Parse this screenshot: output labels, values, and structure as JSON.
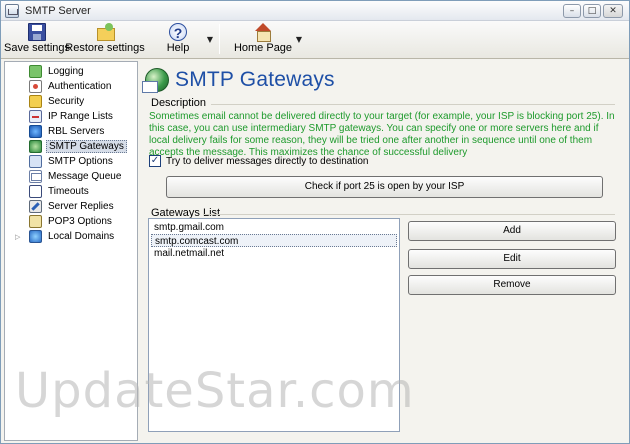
{
  "window": {
    "title": "SMTP Server"
  },
  "titlebar": {
    "minimize": "–",
    "maximize": "□",
    "close": "✕"
  },
  "toolbar": {
    "save_label": "Save settings",
    "restore_label": "Restore settings",
    "help_label": "Help",
    "help_glyph": "?",
    "home_label": "Home Page",
    "dropdown_glyph": "▼"
  },
  "sidebar": {
    "expand_glyph": "▷",
    "items": [
      {
        "label": "Logging",
        "icon": "logging-icon"
      },
      {
        "label": "Authentication",
        "icon": "authentication-icon"
      },
      {
        "label": "Security",
        "icon": "lock-icon"
      },
      {
        "label": "IP Range Lists",
        "icon": "ip-list-icon"
      },
      {
        "label": "RBL Servers",
        "icon": "globe-icon"
      },
      {
        "label": "SMTP Gateways",
        "icon": "gateway-icon",
        "selected": true
      },
      {
        "label": "SMTP Options",
        "icon": "options-icon"
      },
      {
        "label": "Message Queue",
        "icon": "queue-icon"
      },
      {
        "label": "Timeouts",
        "icon": "clock-icon"
      },
      {
        "label": "Server Replies",
        "icon": "reply-icon"
      },
      {
        "label": "POP3 Options",
        "icon": "pop3-icon"
      },
      {
        "label": "Local Domains",
        "icon": "domains-icon"
      }
    ]
  },
  "main": {
    "title": "SMTP Gateways",
    "description_label": "Description",
    "description": "Sometimes email cannot be delivered directly to your target (for example, your ISP is blocking port 25). In this case, you can use intermediary SMTP gateways. You can specify one or more servers here and if local delivery fails for some reason, they will be tried one after another in sequence until one of them accepts the message. This maximizes the chance of successful delivery",
    "direct_delivery_checkbox": {
      "label": "Try to deliver messages directly to destination",
      "checked": true,
      "glyph": "✓"
    },
    "check_port_button": "Check if port 25 is open by your ISP",
    "gateways_label": "Gateways List",
    "gateways": [
      "smtp.gmail.com",
      "smtp.comcast.com",
      "mail.netmail.net"
    ],
    "selected_gateway_index": 1,
    "add_button": "Add",
    "edit_button": "Edit",
    "remove_button": "Remove"
  },
  "watermark": "UpdateStar.com",
  "colors": {
    "title_blue": "#1e4fa6",
    "description_green": "#1e9a2c",
    "selection_bg": "#d6dde8"
  }
}
